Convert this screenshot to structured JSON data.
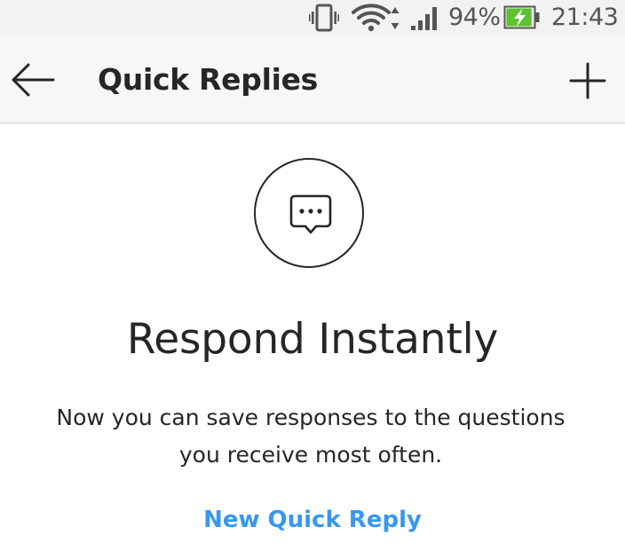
{
  "status_bar": {
    "battery_percent": "94%",
    "battery_level": 0.94,
    "battery_charging": true,
    "time": "21:43",
    "icons": [
      "vibrate-icon",
      "wifi-icon",
      "signal-icon",
      "battery-charging-icon"
    ]
  },
  "header": {
    "back_icon": "arrow-left-icon",
    "title": "Quick Replies",
    "add_icon": "plus-icon"
  },
  "empty_state": {
    "icon": "chat-bubble-ellipsis-icon",
    "heading": "Respond Instantly",
    "description": "Now you can save responses to the questions you receive most often.",
    "action_label": "New Quick Reply"
  },
  "colors": {
    "link_blue": "#3897f0",
    "text_dark": "#262626",
    "battery_green": "#5ec130"
  }
}
